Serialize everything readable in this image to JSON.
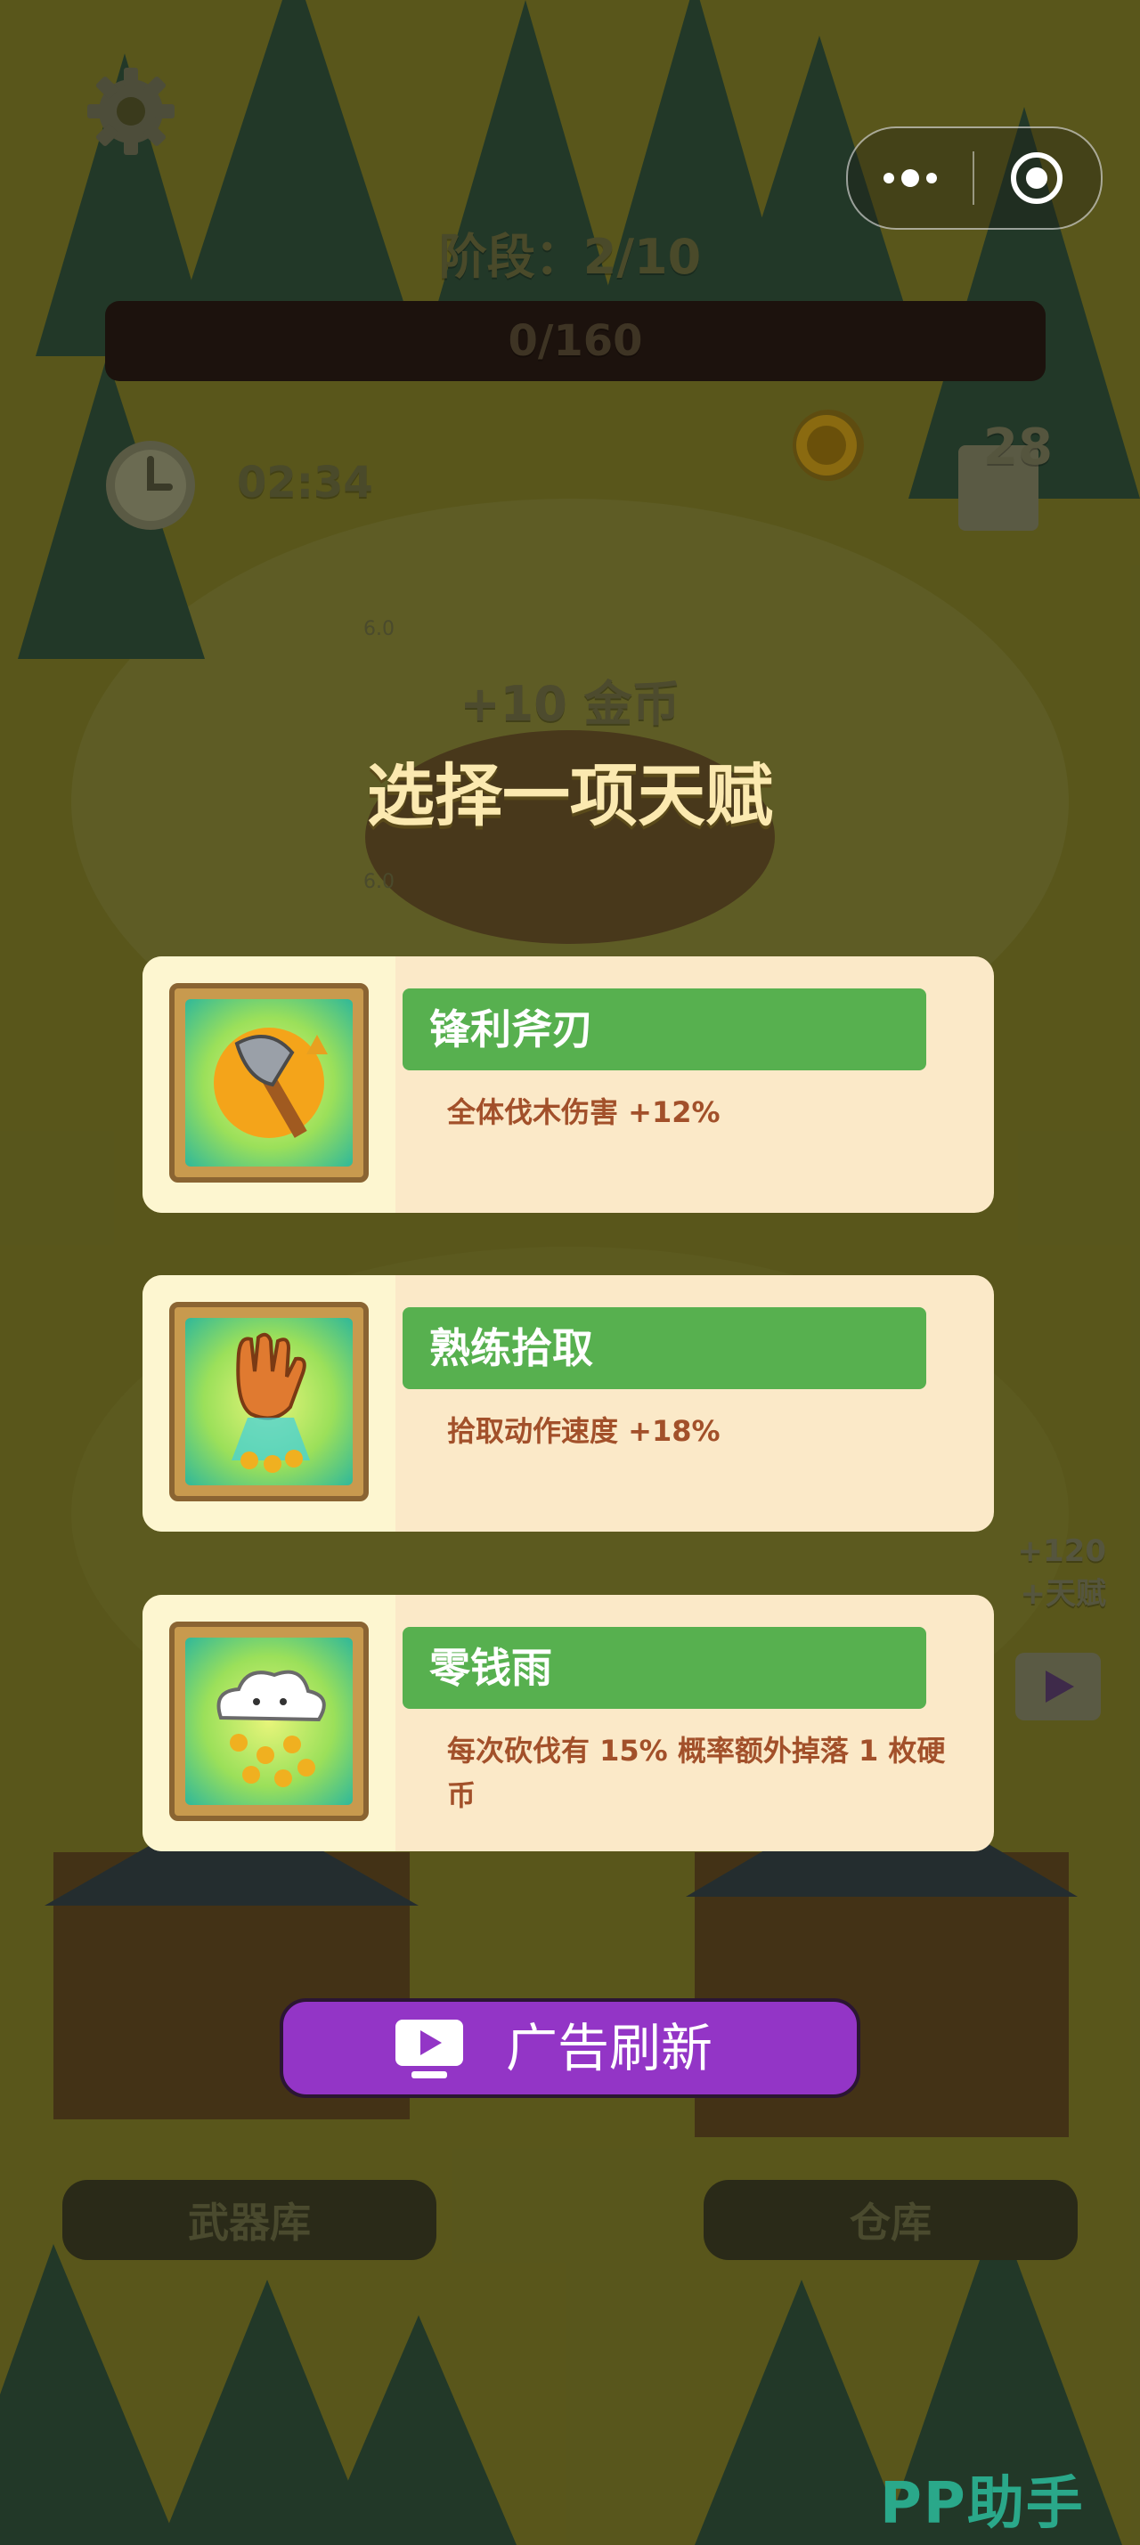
{
  "hud": {
    "stage_text": "阶段：2/10",
    "progress_text": "0/160",
    "timer": "02:34",
    "counter": "28",
    "settings_icon": "gear-icon",
    "clock_icon": "clock-icon",
    "coin_icon": "coin-icon",
    "more_icon": "more-dots-icon",
    "record_icon": "record-target-icon"
  },
  "world": {
    "tick_top": "6.0",
    "tick_mid": "6.0",
    "reward_note_amount": "+120",
    "reward_note_label": "+天赋"
  },
  "overlay": {
    "gain_text": "+10 金币",
    "heading": "选择一项天赋"
  },
  "talents": [
    {
      "name": "锋利斧刃",
      "desc": "全体伐木伤害 +12%",
      "icon": "axe-icon"
    },
    {
      "name": "熟练拾取",
      "desc": "拾取动作速度 +18%",
      "icon": "glove-icon"
    },
    {
      "name": "零钱雨",
      "desc": "每次砍伐有 15% 概率额外掉落 1 枚硬币",
      "icon": "cloud-coins-icon"
    }
  ],
  "ad_refresh": {
    "label": "广告刷新",
    "icon": "tv-play-icon"
  },
  "bottom": {
    "armory": "武器库",
    "warehouse": "仓库"
  },
  "watermark": "PP助手",
  "colors": {
    "card_bg": "#fbe9c8",
    "title_green": "#57b04f",
    "desc_brown": "#a2502a",
    "ad_purple": "#9335c6",
    "heading_yellow": "#fbe9b0"
  }
}
